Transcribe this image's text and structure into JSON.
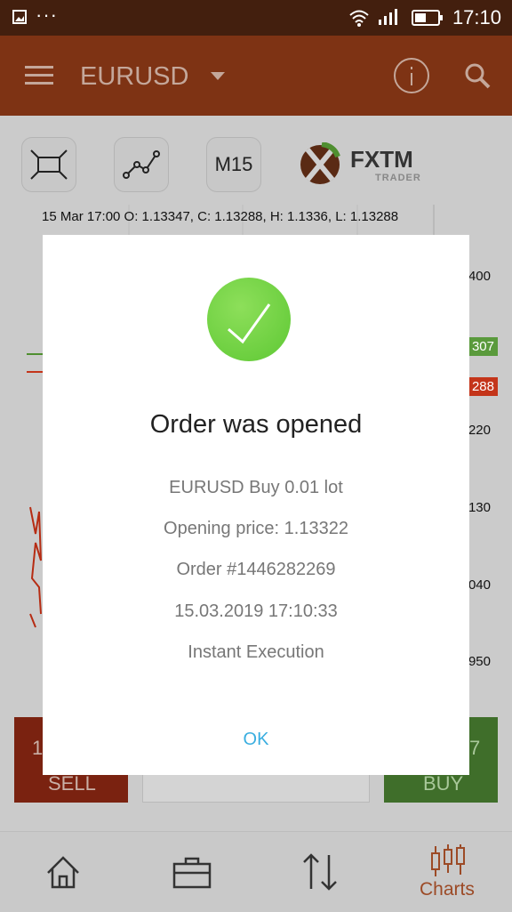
{
  "status_bar": {
    "time": "17:10",
    "dots": "···"
  },
  "app_bar": {
    "symbol": "EURUSD"
  },
  "toolbar": {
    "timeframe": "M15",
    "brand": "FXTM",
    "brand_sub": "TRADER"
  },
  "chart": {
    "ohlc_info": "15 Mar 17:00 O: 1.13347, C: 1.13288, H: 1.1336, L: 1.13288",
    "price_labels": [
      "400",
      "220",
      "130",
      "040",
      "950"
    ],
    "green_tag": "307",
    "red_tag": "288"
  },
  "trade": {
    "sell_label": "SELL",
    "sell_digit": "1",
    "buy_label": "BUY",
    "buy_digit": "7"
  },
  "bottom_nav": {
    "charts_label": "Charts"
  },
  "dialog": {
    "title": "Order was opened",
    "lines": [
      "EURUSD Buy 0.01 lot",
      "Opening price: 1.13322",
      "Order #1446282269",
      "15.03.2019 17:10:33",
      "Instant Execution"
    ],
    "ok_label": "OK"
  },
  "colors": {
    "accent": "#7e3314",
    "sell": "#c4351a",
    "buy": "#5a9a3c",
    "ok": "#3aaee0",
    "check": "#6ed13f"
  }
}
